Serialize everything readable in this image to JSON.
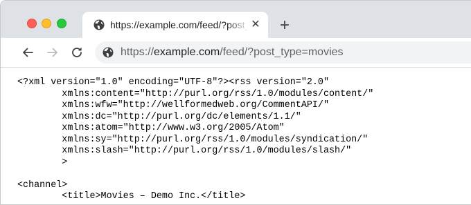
{
  "tab": {
    "title": "https://example.com/feed/?post_type=movies",
    "favicon": "globe-icon",
    "close_glyph": "✕"
  },
  "new_tab_glyph": "+",
  "toolbar": {
    "back_icon": "arrow-left-icon",
    "forward_icon": "arrow-right-icon",
    "reload_icon": "reload-icon",
    "url_prefix": "https://",
    "url_host": "example.com",
    "url_path": "/feed/?post_type=movies"
  },
  "colors": {
    "tabstrip": "#dee1e6",
    "omnibox": "#f1f3f4",
    "close": "#fe5f57",
    "minimize": "#febc2e",
    "zoom": "#28c840"
  },
  "xml_lines": [
    "<?xml version=\"1.0\" encoding=\"UTF-8\"?><rss version=\"2.0\"",
    "        xmlns:content=\"http://purl.org/rss/1.0/modules/content/\"",
    "        xmlns:wfw=\"http://wellformedweb.org/CommentAPI/\"",
    "        xmlns:dc=\"http://purl.org/dc/elements/1.1/\"",
    "        xmlns:atom=\"http://www.w3.org/2005/Atom\"",
    "        xmlns:sy=\"http://purl.org/rss/1.0/modules/syndication/\"",
    "        xmlns:slash=\"http://purl.org/rss/1.0/modules/slash/\"",
    "        >",
    "",
    "<channel>",
    "        <title>Movies – Demo Inc.</title>"
  ]
}
